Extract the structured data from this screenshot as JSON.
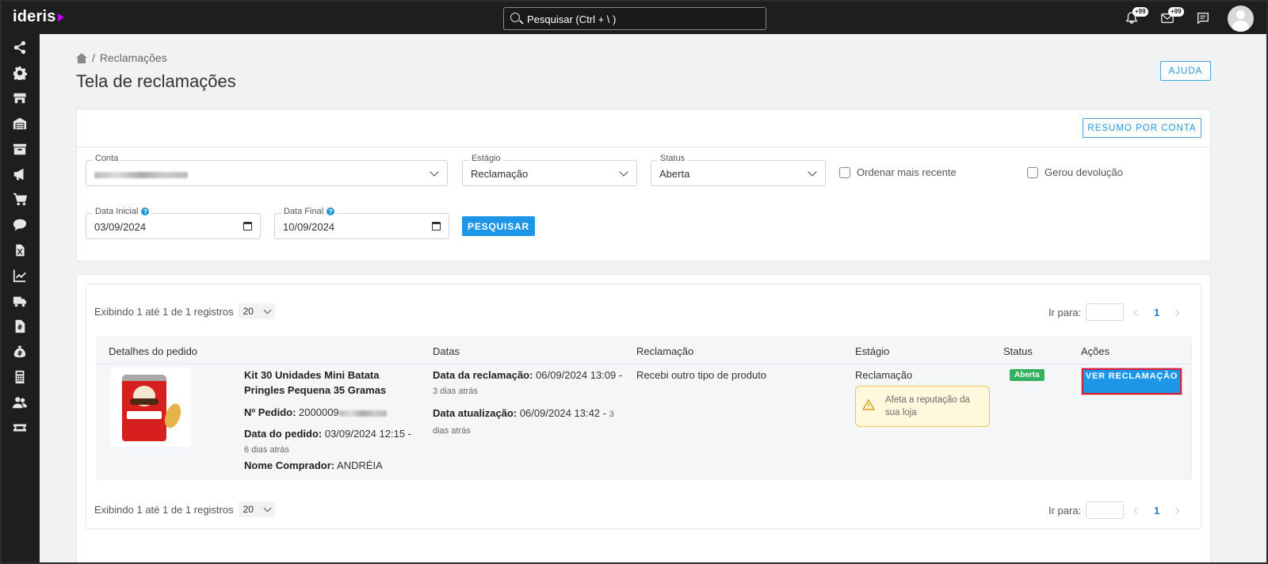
{
  "app": {
    "logo": "ideris"
  },
  "search": {
    "placeholder": "Pesquisar (Ctrl + \\ )"
  },
  "topbar": {
    "notifications_badge": "+99",
    "messages_badge": "+99"
  },
  "sidebar": {
    "icons": [
      "share-icon",
      "gear-icon",
      "store-icon",
      "warehouse-icon",
      "archive-icon",
      "megaphone-icon",
      "cart-icon",
      "chat-icon",
      "excel-file-icon",
      "chart-line-icon",
      "truck-icon",
      "invoice-icon",
      "money-bag-icon",
      "calculator-icon",
      "users-icon",
      "ticket-icon"
    ]
  },
  "breadcrumb": {
    "current": "Reclamações",
    "separator": "/"
  },
  "page": {
    "title": "Tela de reclamações",
    "help_button": "AJUDA"
  },
  "filters": {
    "summary_button": "RESUMO POR CONTA",
    "account": {
      "label": "Conta",
      "value": ""
    },
    "stage": {
      "label": "Estágio",
      "value": "Reclamação"
    },
    "status": {
      "label": "Status",
      "value": "Aberta"
    },
    "order_recent": {
      "label": "Ordenar mais recente",
      "checked": false
    },
    "generated_return": {
      "label": "Gerou devolução",
      "checked": false
    },
    "start_date": {
      "label": "Data Inicial",
      "value": "03/09/2024"
    },
    "end_date": {
      "label": "Data Final",
      "value": "10/09/2024"
    },
    "search_button": "PESQUISAR"
  },
  "results": {
    "info_text": "Exibindo 1 até 1 de 1 registros",
    "page_size": "20",
    "goto_label": "Ir para:",
    "current_page": "1",
    "columns": [
      "Detalhes do pedido",
      "Datas",
      "Reclamação",
      "Estágio",
      "Status",
      "Ações"
    ],
    "rows": [
      {
        "product_title": "Kit 30 Unidades Mini Batata Pringles Pequena 35 Gramas",
        "order_label": "Nº Pedido:",
        "order_value": "2000009",
        "order_date_label": "Data do pedido:",
        "order_date": "03/09/2024 12:15",
        "order_date_ago": "6 dias atrás",
        "buyer_label": "Nome Comprador:",
        "buyer": "ANDRÉIA",
        "claim_date_label": "Data da reclamação:",
        "claim_date": "06/09/2024 13:09",
        "claim_date_ago": "3 dias atrás",
        "update_date_label": "Data atualização:",
        "update_date": "06/09/2024 13:42",
        "update_date_ago": "3 dias atrás",
        "claim_reason": "Recebi outro tipo de produto",
        "stage": "Reclamação",
        "warning": "Afeta a reputação da sua loja",
        "status": "Aberta",
        "action": "VER RECLAMAÇÃO"
      }
    ]
  },
  "colors": {
    "primary": "#1e96e8",
    "status_open": "#34b05e",
    "warning_bg": "#fff8dc",
    "sidebar_bg": "#1e1e1e"
  }
}
